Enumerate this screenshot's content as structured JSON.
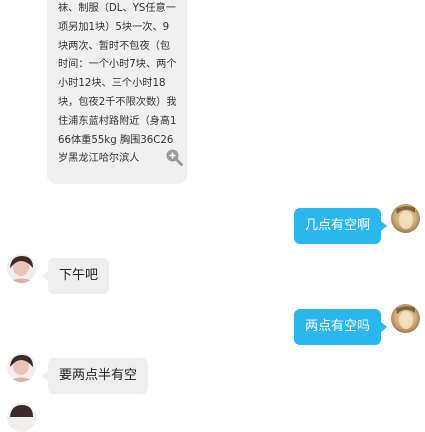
{
  "messages": [
    {
      "side": "left",
      "type": "text-with-zoom",
      "text": "袜、制服（DL、YS任意一项另加1块）5块一次、9块两次、暂时不包夜（包时间：一个小时7块、两个小时12块、三个小时18块，包夜2千不限次数）我住浦东蓝村路附近（身高166体重55kg 胸围36C26岁黑龙江哈尔滨人",
      "icon": "zoom-in-icon"
    },
    {
      "side": "right",
      "text": "几点有空啊"
    },
    {
      "side": "left",
      "text": "下午吧"
    },
    {
      "side": "right",
      "text": "两点有空吗"
    },
    {
      "side": "left",
      "text": "要两点半有空"
    }
  ],
  "colors": {
    "right_bubble": "#2ab7ee",
    "left_bubble": "#eeeeee",
    "long_bubble": "#f0f0f0"
  }
}
